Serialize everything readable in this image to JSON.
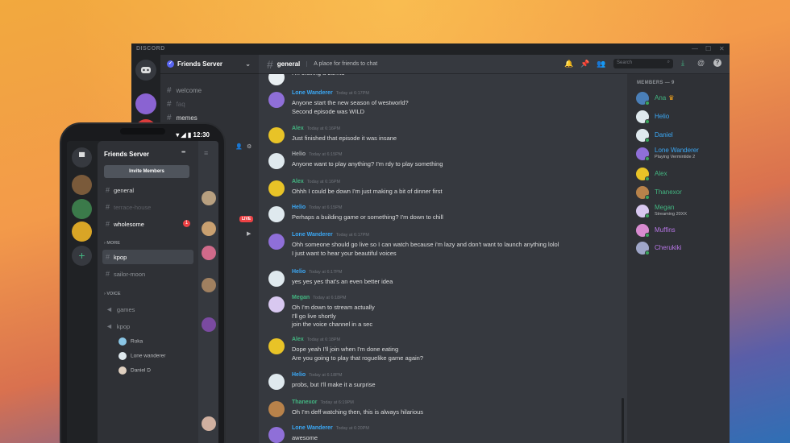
{
  "window": {
    "brand": "DISCORD",
    "controls": [
      "—",
      "☐",
      "✕"
    ]
  },
  "server": {
    "name": "Friends Server",
    "channels": [
      {
        "name": "welcome"
      },
      {
        "name": "faq"
      },
      {
        "name": "memes"
      }
    ]
  },
  "chat": {
    "channel": "general",
    "topic": "A place for friends to chat",
    "search_placeholder": "Search",
    "messages": [
      {
        "author": "",
        "time": "",
        "color": "#ffffff",
        "avatar": "#e9eff2",
        "lines": [
          "I'm craving a burrito"
        ]
      },
      {
        "author": "Lone Wanderer",
        "time": "Today at 6:17PM",
        "color": "#3ba8f5",
        "avatar": "#8f6fd8",
        "lines": [
          "Anyone start the new season of westworld?",
          "Second episode was WILD"
        ]
      },
      {
        "author": "Alex",
        "time": "Today at 6:16PM",
        "color": "#43b581",
        "avatar": "#e8c327",
        "lines": [
          "Just finished that episode it was insane"
        ]
      },
      {
        "author": "Helio",
        "time": "Today at 6:15PM",
        "color": "#a3a6aa",
        "avatar": "#dfe9ee",
        "lines": [
          "Anyone want to play anything? I'm rdy to play something"
        ]
      },
      {
        "author": "Alex",
        "time": "Today at 6:16PM",
        "color": "#43b581",
        "avatar": "#e8c327",
        "lines": [
          "Ohhh I could be down I'm just making a bit of dinner first"
        ]
      },
      {
        "author": "Helio",
        "time": "Today at 6:15PM",
        "color": "#3ba8f5",
        "avatar": "#dfe9ee",
        "lines": [
          "Perhaps a building game or something? I'm down to chill"
        ]
      },
      {
        "author": "Lone Wanderer",
        "time": "Today at 6:17PM",
        "color": "#3ba8f5",
        "avatar": "#8f6fd8",
        "lines": [
          "Ohh someone should go live so I can watch because i'm lazy and don't want to launch anything lolol",
          "I just want to hear your beautiful voices"
        ]
      },
      {
        "author": "Helio",
        "time": "Today at 6:17PM",
        "color": "#3ba8f5",
        "avatar": "#dfe9ee",
        "lines": [
          "yes yes yes that's an even better idea"
        ]
      },
      {
        "author": "Megan",
        "time": "Today at 6:18PM",
        "color": "#43b581",
        "avatar": "#d8c8f0",
        "lines": [
          "Oh I'm down to stream actually",
          "I'll go live shortly",
          "join the voice channel in a sec"
        ]
      },
      {
        "author": "Alex",
        "time": "Today at 6:18PM",
        "color": "#43b581",
        "avatar": "#e8c327",
        "lines": [
          "Dope yeah I'll join when I'm done eating",
          "Are you going to play that roguelike game again?"
        ]
      },
      {
        "author": "Helio",
        "time": "Today at 6:18PM",
        "color": "#3ba8f5",
        "avatar": "#dfe9ee",
        "lines": [
          "probs, but I'll make it a surprise"
        ]
      },
      {
        "author": "Thanexor",
        "time": "Today at 6:19PM",
        "color": "#43b581",
        "avatar": "#b8824a",
        "lines": [
          "Oh I'm deff watching then, this is always hilarious"
        ]
      },
      {
        "author": "Lone Wanderer",
        "time": "Today at 6:20PM",
        "color": "#3ba8f5",
        "avatar": "#8f6fd8",
        "lines": [
          "awesome"
        ]
      }
    ]
  },
  "members": {
    "header": "MEMBERS — 9",
    "list": [
      {
        "name": "Ana",
        "extra": "♛",
        "status": "",
        "color": "#43b581",
        "avatar": "#4a7fb8"
      },
      {
        "name": "Helio",
        "extra": "",
        "status": "",
        "color": "#3ba8f5",
        "avatar": "#dfe9ee"
      },
      {
        "name": "Daniel",
        "extra": "",
        "status": "",
        "color": "#3ba8f5",
        "avatar": "#dfe9ee"
      },
      {
        "name": "Lone Wanderer",
        "extra": "",
        "status": "Playing Vermintide 2",
        "color": "#3ba8f5",
        "avatar": "#8f6fd8"
      },
      {
        "name": "Alex",
        "extra": "",
        "status": "",
        "color": "#43b581",
        "avatar": "#e8c327"
      },
      {
        "name": "Thanexor",
        "extra": "",
        "status": "",
        "color": "#43b581",
        "avatar": "#b8824a"
      },
      {
        "name": "Megan",
        "extra": "",
        "status": "Streaming 20XX",
        "color": "#43b581",
        "avatar": "#d8c8f0"
      },
      {
        "name": "Muffins",
        "extra": "",
        "status": "",
        "color": "#b676e5",
        "avatar": "#d88bd0"
      },
      {
        "name": "Cherukiki",
        "extra": "",
        "status": "",
        "color": "#b676e5",
        "avatar": "#9fa6c9"
      }
    ]
  },
  "phone": {
    "time": "12:30",
    "server_name": "Friends Server",
    "menu_glyph": "•••",
    "invite_label": "Invite Members",
    "top_channels": [
      {
        "name": "general",
        "state": "normal",
        "badge": ""
      },
      {
        "name": "terrace-house",
        "state": "muted",
        "badge": ""
      },
      {
        "name": "wholesome",
        "state": "unread",
        "badge": "1"
      }
    ],
    "more_label": "MORE",
    "more_channels": [
      {
        "name": "kpop",
        "state": "active"
      },
      {
        "name": "sailor-moon",
        "state": "normal"
      }
    ],
    "voice_label": "VOICE",
    "voice_channels": [
      {
        "name": "games"
      },
      {
        "name": "kpop"
      }
    ],
    "voice_users": [
      {
        "name": "Roka",
        "avatar": "#8ac6e6"
      },
      {
        "name": "Lone wanderer",
        "avatar": "#dfe9ee"
      },
      {
        "name": "Daniel D",
        "avatar": "#e0d0c0"
      }
    ],
    "live_label": "LIVE"
  }
}
